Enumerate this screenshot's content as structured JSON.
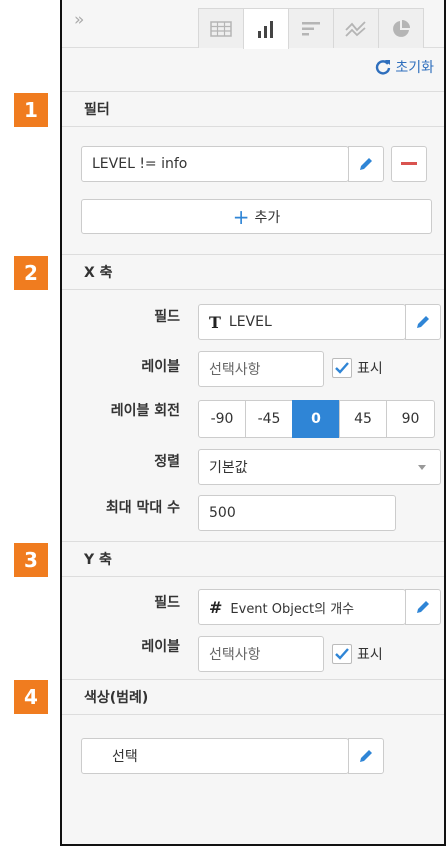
{
  "toolbar": {
    "collapse": "»",
    "tabs": [
      {
        "icon": "table-icon",
        "active": false
      },
      {
        "icon": "bar-chart-icon",
        "active": true
      },
      {
        "icon": "horizontal-bar-icon",
        "active": false
      },
      {
        "icon": "line-chart-icon",
        "active": false
      },
      {
        "icon": "pie-chart-icon",
        "active": false
      }
    ],
    "reset_label": "초기화"
  },
  "badges": [
    "1",
    "2",
    "3",
    "4"
  ],
  "filter": {
    "title": "필터",
    "expression": "LEVEL != info",
    "add_label": "추가"
  },
  "x_axis": {
    "title": "X 축",
    "field_label": "필드",
    "field_type_icon": "T",
    "field_value": "LEVEL",
    "label_label": "레이블",
    "label_placeholder": "선택사항",
    "show_label": "표시",
    "show_checked": true,
    "rotation_label": "레이블 회전",
    "rotation_options": [
      "-90",
      "-45",
      "0",
      "45",
      "90"
    ],
    "rotation_selected": "0",
    "sort_label": "정렬",
    "sort_value": "기본값",
    "max_bars_label": "최대 막대 수",
    "max_bars_value": "500"
  },
  "y_axis": {
    "title": "Y 축",
    "field_label": "필드",
    "field_type_icon": "#",
    "field_value": "Event Object의 개수",
    "label_label": "레이블",
    "label_placeholder": "선택사항",
    "show_label": "표시",
    "show_checked": true
  },
  "color": {
    "title": "색상(범례)",
    "select_label": "선택"
  },
  "colors": {
    "accent": "#2f85d6",
    "badge": "#f07c1f",
    "remove": "#d9534f",
    "link": "#2f6fbd"
  }
}
